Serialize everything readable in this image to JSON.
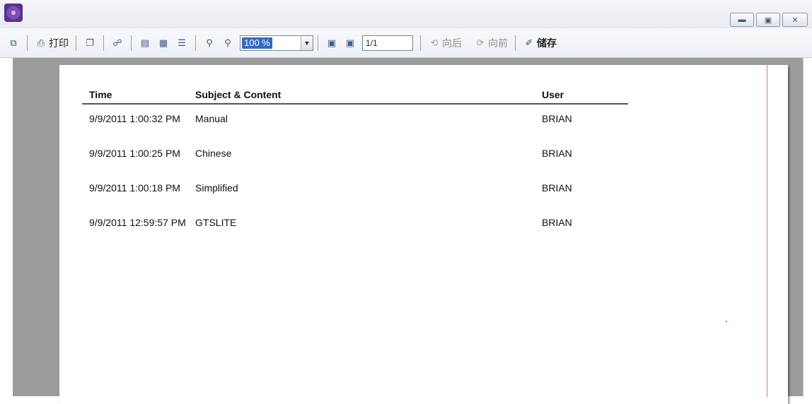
{
  "toolbar": {
    "print_label": "打印",
    "zoom_value": "100 %",
    "page_value": "1/1",
    "back_label": "向后",
    "forward_label": "向前",
    "save_label": "储存"
  },
  "report": {
    "headers": {
      "time": "Time",
      "subject": "Subject & Content",
      "user": "User"
    },
    "rows": [
      {
        "time": "9/9/2011 1:00:32 PM",
        "subject": "Manual",
        "user": "BRIAN"
      },
      {
        "time": "9/9/2011 1:00:25 PM",
        "subject": "Chinese",
        "user": "BRIAN"
      },
      {
        "time": "9/9/2011 1:00:18 PM",
        "subject": "Simplified",
        "user": "BRIAN"
      },
      {
        "time": "9/9/2011 12:59:57 PM",
        "subject": "GTSLITE",
        "user": "BRIAN"
      }
    ]
  },
  "icons": {
    "app": "app-logo-icon",
    "export": "export-icon",
    "print": "printer-icon",
    "copy": "copy-icon",
    "find": "binoculars-icon",
    "zoom_in": "zoom-in-icon",
    "zoom_out": "zoom-out-icon",
    "save": "pen-icon"
  },
  "colors": {
    "zoom_highlight": "#3169c6",
    "margin_line": "#e57373",
    "viewer_gray": "#9c9c9c"
  }
}
